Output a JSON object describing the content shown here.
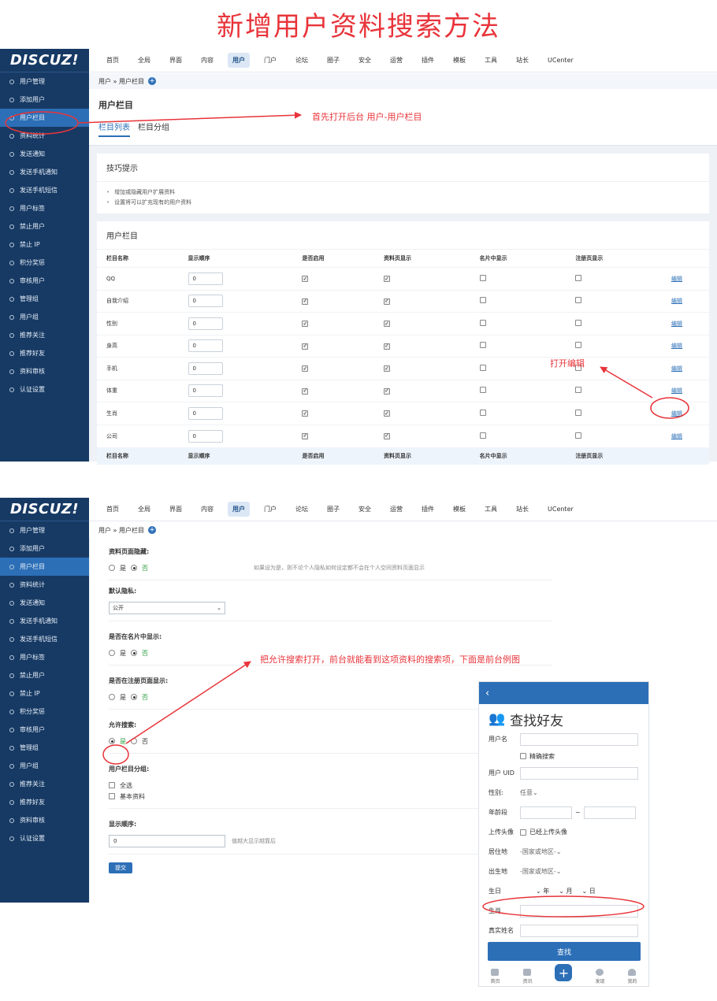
{
  "title": "新增用户资料搜索方法",
  "brand": {
    "logo": "DISCUZ!",
    "accent": "#2c6fb7",
    "sidebar_bg": "#173a64",
    "callout": "#e8343a"
  },
  "topnav": [
    "首页",
    "全局",
    "界面",
    "内容",
    "用户",
    "门户",
    "论坛",
    "圈子",
    "安全",
    "运营",
    "插件",
    "模板",
    "工具",
    "站长",
    "UCenter"
  ],
  "sidebar": [
    "用户管理",
    "添加用户",
    "用户栏目",
    "资料统计",
    "发送通知",
    "发送手机通知",
    "发送手机短信",
    "用户标签",
    "禁止用户",
    "禁止 IP",
    "积分奖惩",
    "审核用户",
    "管理组",
    "用户组",
    "推荐关注",
    "推荐好友",
    "资料审核",
    "认证设置"
  ],
  "breadcrumb": "用户 » 用户栏目",
  "page_title": "用户栏目",
  "tabs": [
    "栏目列表",
    "栏目分组"
  ],
  "tips": {
    "title": "技巧提示",
    "items": [
      "增加或隐藏用户扩展资料",
      "设置将可以扩充现有的用户资料"
    ]
  },
  "table": {
    "title": "用户栏目",
    "headers": [
      "栏目名称",
      "显示顺序",
      "是否启用",
      "资料页显示",
      "名片中显示",
      "注册页显示"
    ],
    "rows": [
      {
        "name": "QQ",
        "order": "0"
      },
      {
        "name": "自我介绍",
        "order": "0"
      },
      {
        "name": "性别",
        "order": "0"
      },
      {
        "name": "身高",
        "order": "0"
      },
      {
        "name": "手机",
        "order": "0"
      },
      {
        "name": "体重",
        "order": "0"
      },
      {
        "name": "生肖",
        "order": "0"
      },
      {
        "name": "公司",
        "order": "0"
      }
    ],
    "edit_label": "编辑"
  },
  "callouts": {
    "c1": "首先打开后台 用户-用户栏目",
    "c2": "打开编辑",
    "c3": "把允许搜索打开，前台就能看到这项资料的搜索项，下面是前台例图"
  },
  "form": {
    "hide_profile": {
      "label": "资料页面隐藏:",
      "yes": "是",
      "no": "否",
      "hint": "如果设为是，则不论个人隐私如何设定都不会在个人空间资料页面显示"
    },
    "default_privacy": {
      "label": "默认隐私:",
      "value": "公开"
    },
    "show_card": {
      "label": "是否在名片中显示:",
      "yes": "是",
      "no": "否"
    },
    "show_register": {
      "label": "是否在注册页面显示:",
      "yes": "是",
      "no": "否"
    },
    "allow_search": {
      "label": "允许搜索:",
      "yes": "是",
      "no": "否"
    },
    "group": {
      "label": "用户栏目分组:",
      "options": [
        "全选",
        "基本资料"
      ]
    },
    "display_order": {
      "label": "显示顺序:",
      "value": "0",
      "hint": "值越大显示越靠后"
    },
    "submit": "提交"
  },
  "mobile": {
    "back": "‹",
    "title": "查找好友",
    "fields": {
      "username": "用户名",
      "exact": "精确搜索",
      "uid": "用户 UID",
      "gender": "性别:",
      "gender_val": "任意",
      "age": "年龄段",
      "tilde": "~",
      "avatar": "上传头像",
      "avatar_opt": "已经上传头像",
      "residence": "居住地",
      "residence_val": "-国家或地区-",
      "birthplace": "出生地",
      "birthplace_val": "-国家或地区-",
      "birthday": "生日",
      "year": "年",
      "month": "月",
      "day": "日",
      "zodiac": "生肖",
      "realname": "真实姓名"
    },
    "search_btn": "查找",
    "bottom": [
      "首页",
      "资讯",
      "发现",
      "我的"
    ]
  }
}
